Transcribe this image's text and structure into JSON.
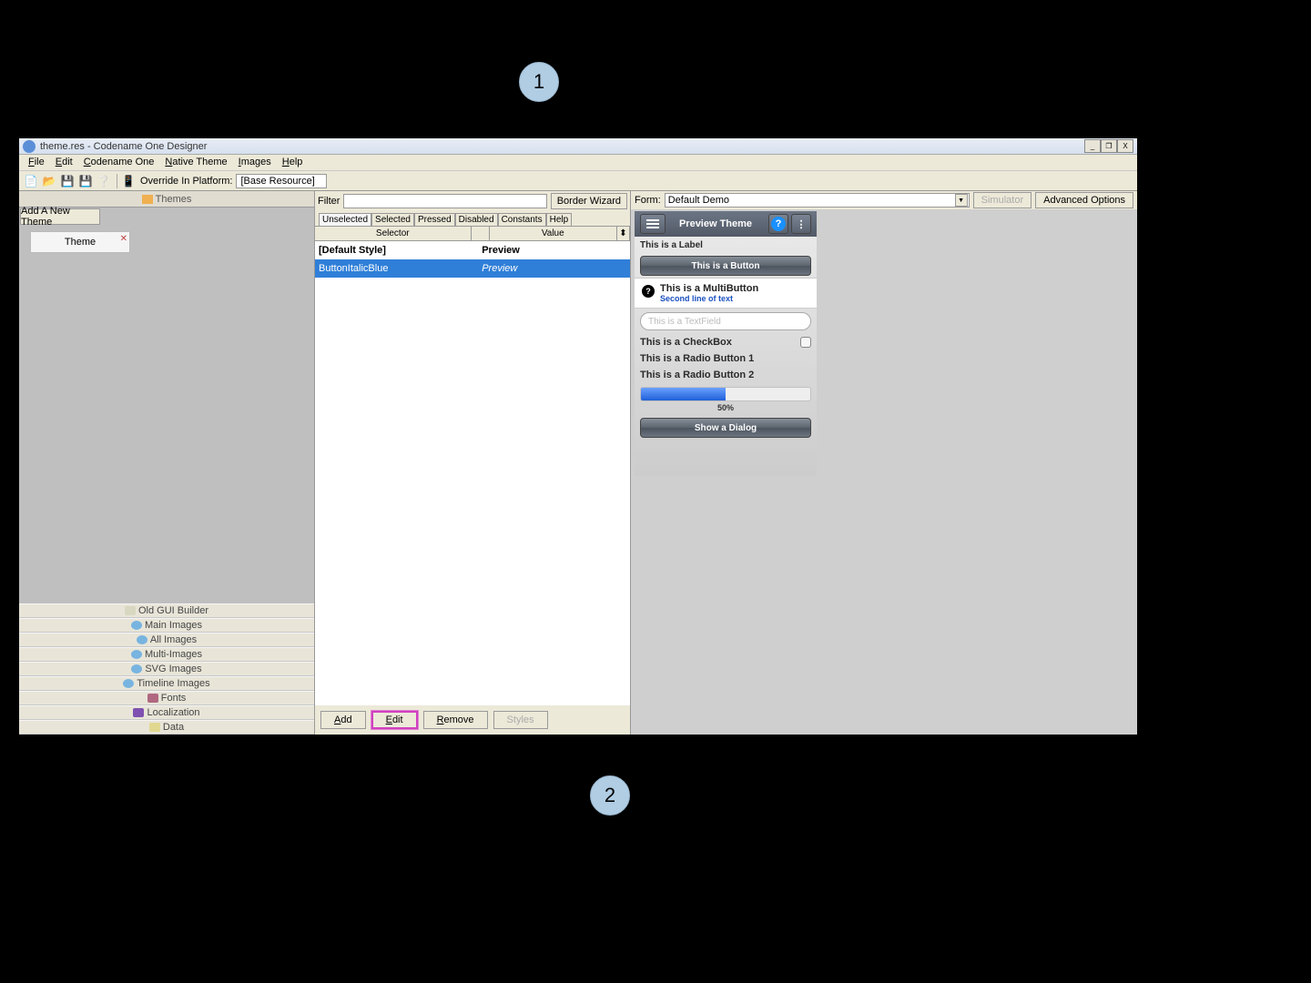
{
  "callouts": {
    "c1": "1",
    "c2": "2"
  },
  "window": {
    "title": "theme.res - Codename One Designer",
    "min": "_",
    "max": "❐",
    "close": "X"
  },
  "menubar": [
    "File",
    "Edit",
    "Codename One",
    "Native Theme",
    "Images",
    "Help"
  ],
  "toolbar": {
    "override_label": "Override In Platform:",
    "override_value": "[Base Resource]"
  },
  "left": {
    "themes_header": "Themes",
    "add_theme": "Add A New Theme",
    "theme_item": "Theme",
    "categories": [
      "Old GUI Builder",
      "Main Images",
      "All Images",
      "Multi-Images",
      "SVG Images",
      "Timeline Images",
      "Fonts",
      "Localization",
      "Data"
    ]
  },
  "middle": {
    "filter_label": "Filter",
    "border_wizard": "Border Wizard",
    "tabs": [
      "Unselected",
      "Selected",
      "Pressed",
      "Disabled",
      "Constants",
      "Help"
    ],
    "col_selector": "Selector",
    "col_value": "Value",
    "row_default_selector": "[Default Style]",
    "row_default_value": "Preview",
    "row_selected_selector": "ButtonItalicBlue",
    "row_selected_value": "Preview",
    "buttons": {
      "add": "Add",
      "edit": "Edit",
      "remove": "Remove",
      "styles": "Styles"
    }
  },
  "right": {
    "form_label": "Form:",
    "form_value": "Default Demo",
    "simulator": "Simulator",
    "advanced": "Advanced Options",
    "preview": {
      "title": "Preview Theme",
      "label": "This is a Label",
      "button": "This is a Button",
      "multi_l1": "This is a MultiButton",
      "multi_l2": "Second line of text",
      "textfield": "This is a TextField",
      "checkbox": "This is a CheckBox",
      "radio1": "This is a Radio Button 1",
      "radio2": "This is a Radio Button 2",
      "slider_pct": "50%",
      "dialog": "Show a Dialog"
    }
  }
}
